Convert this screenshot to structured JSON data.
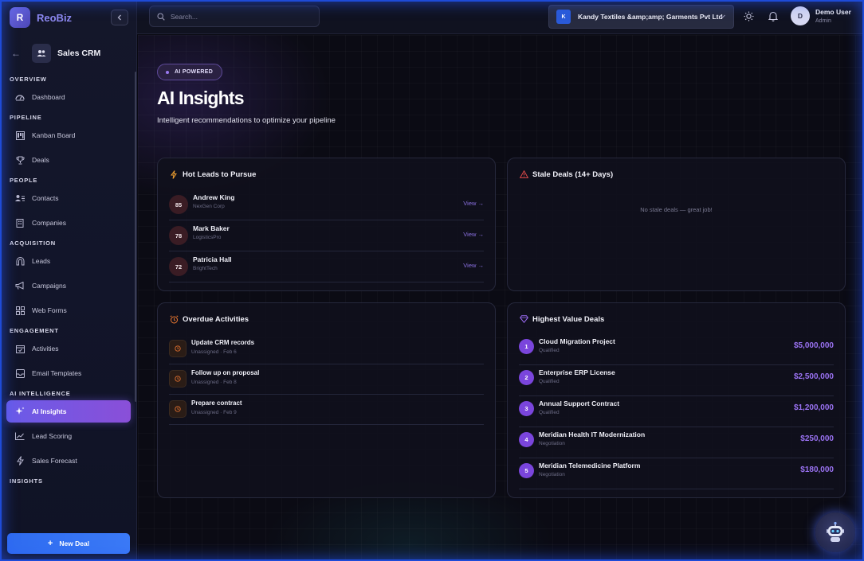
{
  "brand": {
    "logo_letter": "R",
    "name": "ReoBiz"
  },
  "module": {
    "name": "Sales CRM"
  },
  "nav": {
    "sections": [
      {
        "label": "OVERVIEW",
        "items": [
          {
            "label": "Dashboard",
            "icon": "gauge-icon"
          }
        ]
      },
      {
        "label": "PIPELINE",
        "items": [
          {
            "label": "Kanban Board",
            "icon": "kanban-icon"
          },
          {
            "label": "Deals",
            "icon": "trophy-icon"
          }
        ]
      },
      {
        "label": "PEOPLE",
        "items": [
          {
            "label": "Contacts",
            "icon": "contacts-icon"
          },
          {
            "label": "Companies",
            "icon": "building-icon"
          }
        ]
      },
      {
        "label": "ACQUISITION",
        "items": [
          {
            "label": "Leads",
            "icon": "magnet-icon"
          },
          {
            "label": "Campaigns",
            "icon": "megaphone-icon"
          },
          {
            "label": "Web Forms",
            "icon": "forms-icon"
          }
        ]
      },
      {
        "label": "ENGAGEMENT",
        "items": [
          {
            "label": "Activities",
            "icon": "calendar-check-icon"
          },
          {
            "label": "Email Templates",
            "icon": "mail-icon"
          }
        ]
      },
      {
        "label": "AI INTELLIGENCE",
        "items": [
          {
            "label": "AI Insights",
            "icon": "sparkles-icon",
            "active": true
          },
          {
            "label": "Lead Scoring",
            "icon": "trend-icon"
          },
          {
            "label": "Sales Forecast",
            "icon": "bolt-icon"
          }
        ]
      },
      {
        "label": "INSIGHTS",
        "items": []
      }
    ],
    "new_deal_label": "New Deal"
  },
  "topbar": {
    "search_placeholder": "Search...",
    "company": {
      "logo_letter": "K",
      "name": "Kandy Textiles &amp;amp; Garments Pvt Ltd"
    },
    "user": {
      "initial": "D",
      "name": "Demo User",
      "role": "Admin"
    }
  },
  "page": {
    "badge": "AI POWERED",
    "title": "AI Insights",
    "subtitle": "Intelligent recommendations to optimize your pipeline"
  },
  "hot_leads": {
    "title": "Hot Leads to Pursue",
    "view_label": "View →",
    "items": [
      {
        "score": "85",
        "name": "Andrew King",
        "company": "NexGen Corp"
      },
      {
        "score": "78",
        "name": "Mark Baker",
        "company": "LogisticsPro"
      },
      {
        "score": "72",
        "name": "Patricia Hall",
        "company": "BrightTech"
      }
    ]
  },
  "stale_deals": {
    "title": "Stale Deals (14+ Days)",
    "empty_text": "No stale deals — great job!"
  },
  "overdue": {
    "title": "Overdue Activities",
    "items": [
      {
        "name": "Update CRM records",
        "meta": "Unassigned · Feb 6"
      },
      {
        "name": "Follow up on proposal",
        "meta": "Unassigned · Feb 8"
      },
      {
        "name": "Prepare contract",
        "meta": "Unassigned · Feb 9"
      }
    ]
  },
  "high_value": {
    "title": "Highest Value Deals",
    "items": [
      {
        "rank": "1",
        "name": "Cloud Migration Project",
        "stage": "Qualified",
        "value": "$5,000,000"
      },
      {
        "rank": "2",
        "name": "Enterprise ERP License",
        "stage": "Qualified",
        "value": "$2,500,000"
      },
      {
        "rank": "3",
        "name": "Annual Support Contract",
        "stage": "Qualified",
        "value": "$1,200,000"
      },
      {
        "rank": "4",
        "name": "Meridian Health IT Modernization",
        "stage": "Negotiation",
        "value": "$250,000"
      },
      {
        "rank": "5",
        "name": "Meridian Telemedicine Platform",
        "stage": "Negotiation",
        "value": "$180,000"
      }
    ]
  },
  "colors": {
    "accent": "#7a45dc",
    "primary_button": "#2f6cf0",
    "value_text": "#9a72f2"
  }
}
